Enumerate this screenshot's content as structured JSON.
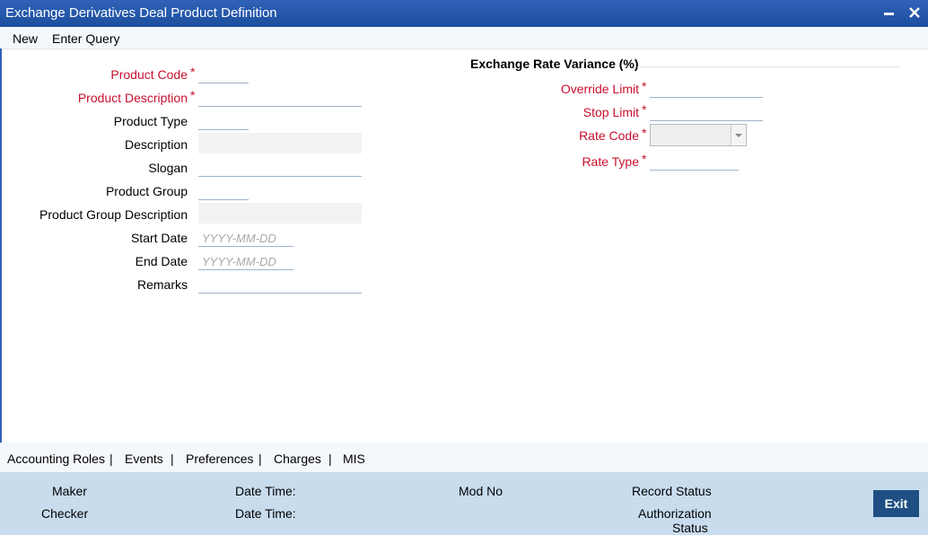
{
  "window": {
    "title": "Exchange Derivatives Deal Product Definition",
    "minimize_glyph": "▬",
    "close_glyph": "✕"
  },
  "menu": {
    "new": "New",
    "enter_query": "Enter Query"
  },
  "form": {
    "product_code": {
      "label": "Product Code",
      "value": ""
    },
    "product_description": {
      "label": "Product Description",
      "value": ""
    },
    "product_type": {
      "label": "Product Type",
      "value": ""
    },
    "description": {
      "label": "Description",
      "value": ""
    },
    "slogan": {
      "label": "Slogan",
      "value": ""
    },
    "product_group": {
      "label": "Product Group",
      "value": ""
    },
    "product_group_description": {
      "label": "Product Group Description",
      "value": ""
    },
    "start_date": {
      "label": "Start Date",
      "placeholder": "YYYY-MM-DD"
    },
    "end_date": {
      "label": "End Date",
      "placeholder": "YYYY-MM-DD"
    },
    "remarks": {
      "label": "Remarks",
      "value": ""
    },
    "required_mark": "*"
  },
  "variance": {
    "heading": "Exchange Rate Variance (%)",
    "override_limit": {
      "label": "Override Limit",
      "value": ""
    },
    "stop_limit": {
      "label": "Stop Limit",
      "value": ""
    },
    "rate_code": {
      "label": "Rate Code",
      "value": ""
    },
    "rate_type": {
      "label": "Rate Type",
      "value": ""
    }
  },
  "tabs": {
    "accounting_roles": "Accounting Roles",
    "events": "Events",
    "preferences": "Preferences",
    "charges": "Charges",
    "mis": "MIS",
    "separator": "|"
  },
  "footer": {
    "maker": "Maker",
    "checker": "Checker",
    "date_time_1": "Date Time:",
    "date_time_2": "Date Time:",
    "mod_no": "Mod No",
    "record_status": "Record Status",
    "authorization": "Authorization",
    "status": "Status",
    "exit": "Exit"
  },
  "colors": {
    "titlebar": "#1d4f9e",
    "required": "#c8102e",
    "footer": "#c8dcee",
    "exit_button": "#1f4f82"
  }
}
